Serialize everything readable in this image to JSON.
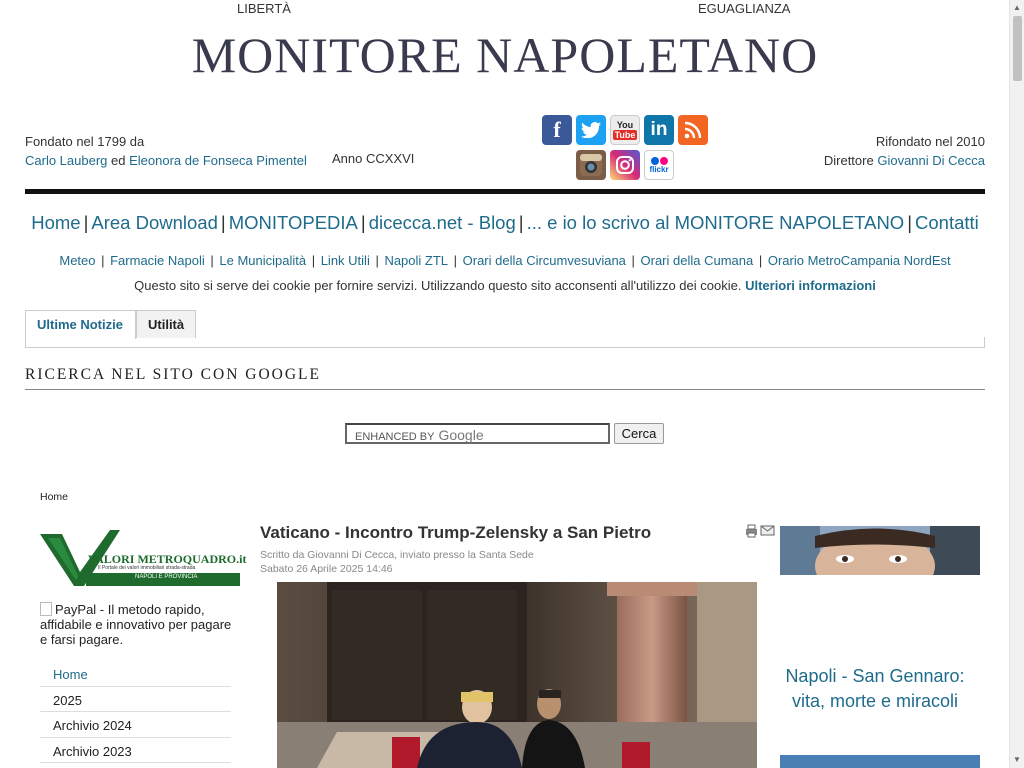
{
  "header": {
    "motto_left": "LIBERTÀ",
    "motto_right": "EGUAGLIANZA",
    "title": "MONITORE NAPOLETANO",
    "founded_text": "Fondato nel 1799 da",
    "founder_1": "Carlo Lauberg",
    "founder_conj": "ed",
    "founder_2": "Eleonora de Fonseca Pimentel",
    "anno": "Anno CCXXVI",
    "refounded_text": "Rifondato nel 2010",
    "director_label": "Direttore",
    "director_name": "Giovanni Di Cecca"
  },
  "social": [
    {
      "icon": "facebook-icon",
      "glyph": "f",
      "color": "#3b5998"
    },
    {
      "icon": "twitter-icon",
      "glyph": "t",
      "color": "#1da1f2"
    },
    {
      "icon": "youtube-icon",
      "glyph": "You",
      "color": "#e52d27"
    },
    {
      "icon": "linkedin-icon",
      "glyph": "in",
      "color": "#0e76a8"
    },
    {
      "icon": "rss-icon",
      "glyph": "◉",
      "color": "#f26522"
    },
    {
      "icon": "instagram-old-icon",
      "glyph": "◎",
      "color": "#6b4d3a"
    },
    {
      "icon": "instagram-icon",
      "glyph": "◎",
      "color": "#d6249f"
    },
    {
      "icon": "flickr-icon",
      "glyph": "flickr",
      "color": "#ffffff"
    }
  ],
  "main_nav": [
    "Home",
    "Area Download",
    "MONITOPEDIA",
    "dicecca.net - Blog",
    "... e io lo scrivo al MONITORE NAPOLETANO",
    "Contatti"
  ],
  "sub_nav": [
    "Meteo",
    "Farmacie Napoli",
    "Le Municipalità",
    "Link Utili",
    "Napoli ZTL",
    "Orari della Circumvesuviana",
    "Orari della Cumana",
    "Orario MetroCampania NordEst"
  ],
  "cookie": {
    "text": "Questo sito si serve dei cookie per fornire servizi. Utilizzando questo sito acconsenti all'utilizzo dei cookie.",
    "link": "Ulteriori informazioni"
  },
  "tabs": [
    "Ultime Notizie",
    "Utilità"
  ],
  "search": {
    "heading": "RICERCA NEL SITO CON GOOGLE",
    "enhanced_by": "ENHANCED BY",
    "google": "Google",
    "button": "Cerca"
  },
  "breadcrumb": "Home",
  "left": {
    "logo_text_1": "VALORI METROQUADRO.it",
    "logo_text_2": "Il Portale dei valori immobiliari strada-strada",
    "logo_text_3": "NAPOLI E PROVINCIA",
    "paypal_alt": "PayPal - Il metodo rapido, affidabile e innovativo per pagare e farsi pagare.",
    "menu": [
      "Home",
      "2025",
      "Archivio 2024",
      "Archivio 2023"
    ]
  },
  "article": {
    "title": "Vaticano - Incontro Trump-Zelensky a San Pietro",
    "author": "Scritto da Giovanni Di Cecca, inviato presso la Santa Sede",
    "date": "Sabato 26 Aprile 2025 14:46"
  },
  "right": {
    "link": "Napoli - San Gennaro: vita, morte e miracoli"
  }
}
